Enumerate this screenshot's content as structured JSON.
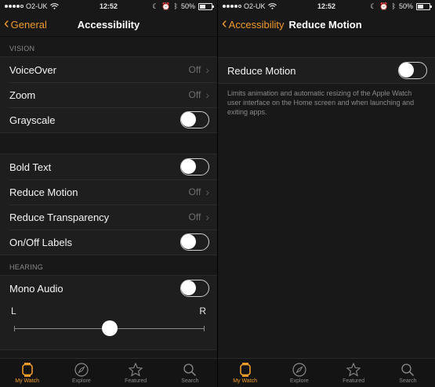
{
  "status": {
    "carrier": "O2-UK",
    "time": "12:52",
    "battery": "50%"
  },
  "left_screen": {
    "back_label": "General",
    "title": "Accessibility",
    "vision_header": "VISION",
    "vision_rows": [
      {
        "label": "VoiceOver",
        "value": "Off"
      },
      {
        "label": "Zoom",
        "value": "Off"
      },
      {
        "label": "Grayscale",
        "toggle": "off"
      }
    ],
    "display_rows": [
      {
        "label": "Bold Text",
        "toggle": "off"
      },
      {
        "label": "Reduce Motion",
        "value": "Off"
      },
      {
        "label": "Reduce Transparency",
        "value": "Off"
      },
      {
        "label": "On/Off Labels",
        "toggle": "off"
      }
    ],
    "hearing_header": "HEARING",
    "mono_audio": {
      "label": "Mono Audio",
      "toggle": "off"
    },
    "balance": {
      "left": "L",
      "right": "R",
      "position": 0.5
    }
  },
  "right_screen": {
    "back_label": "Accessibility",
    "title": "Reduce Motion",
    "row_label": "Reduce Motion",
    "toggle": "off",
    "description": "Limits animation and automatic resizing of the Apple Watch user interface on the Home screen and when launching and exiting apps."
  },
  "tabs": [
    {
      "label": "My Watch",
      "icon": "watch-icon",
      "active": true
    },
    {
      "label": "Explore",
      "icon": "compass-icon",
      "active": false
    },
    {
      "label": "Featured",
      "icon": "star-icon",
      "active": false
    },
    {
      "label": "Search",
      "icon": "search-icon",
      "active": false
    }
  ],
  "colors": {
    "accent": "#f09a2a",
    "background": "#181818",
    "text_secondary": "#8a8a8a"
  }
}
